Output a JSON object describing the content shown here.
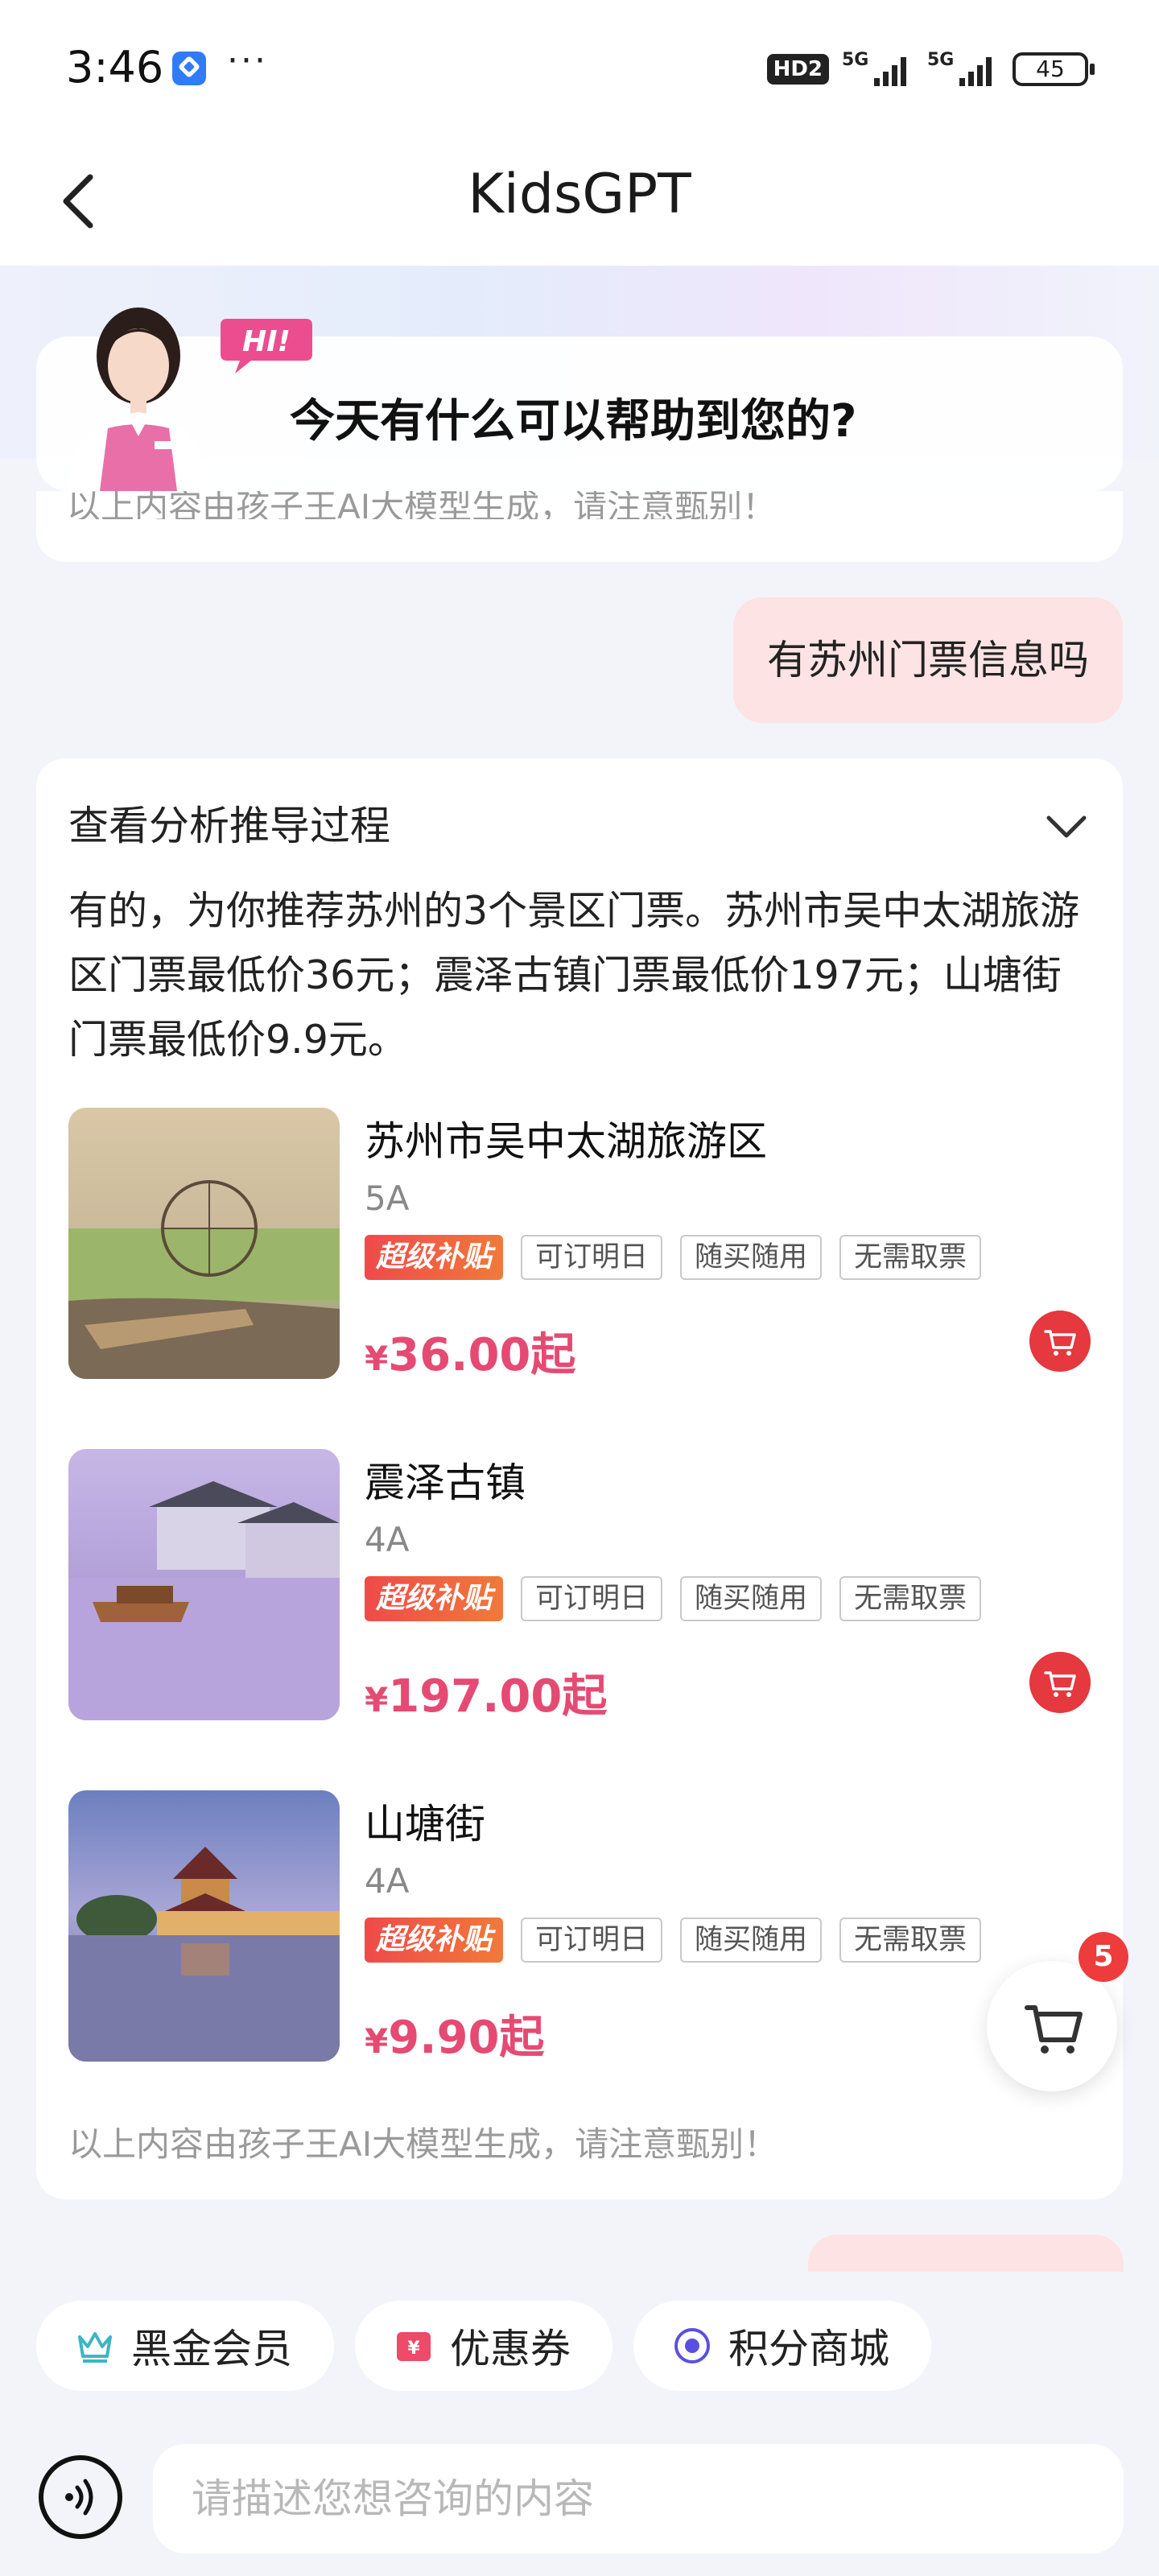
{
  "status_bar": {
    "time": "3:46",
    "dots": "···",
    "hd_label": "HD2",
    "signal1_label": "5G",
    "signal2_label": "5G",
    "battery": "45"
  },
  "nav": {
    "title": "KidsGPT"
  },
  "welcome": {
    "hi": "HI!",
    "greeting": "今天有什么可以帮助到您的?",
    "prev_disclaimer": "以上内容由孩子王AI大模型生成，请注意甄别！"
  },
  "user_message": "有苏州门票信息吗",
  "answer": {
    "analysis_label": "查看分析推导过程",
    "text": "有的，为你推荐苏州的3个景区门票。苏州市吴中太湖旅游区门票最低价36元；震泽古镇门票最低价197元；山塘街门票最低价9.9元。",
    "products": [
      {
        "name": "苏州市吴中太湖旅游区",
        "level": "5A",
        "subsidy_tag": "超级补贴",
        "tags": [
          "可订明日",
          "随买随用",
          "无需取票"
        ],
        "price_symbol": "¥",
        "price": "36.00起"
      },
      {
        "name": "震泽古镇",
        "level": "4A",
        "subsidy_tag": "超级补贴",
        "tags": [
          "可订明日",
          "随买随用",
          "无需取票"
        ],
        "price_symbol": "¥",
        "price": "197.00起"
      },
      {
        "name": "山塘街",
        "level": "4A",
        "subsidy_tag": "超级补贴",
        "tags": [
          "可订明日",
          "随买随用",
          "无需取票"
        ],
        "price_symbol": "¥",
        "price": "9.90起"
      }
    ],
    "disclaimer": "以上内容由孩子王AI大模型生成，请注意甄别！"
  },
  "cart": {
    "count": "5"
  },
  "chips": [
    {
      "label": "黑金会员",
      "icon": "crown-icon"
    },
    {
      "label": "优惠券",
      "icon": "coupon-icon"
    },
    {
      "label": "积分商城",
      "icon": "points-icon"
    }
  ],
  "input": {
    "placeholder": "请描述您想咨询的内容"
  },
  "colors": {
    "accent_price": "#e54a73",
    "cart_red": "#e5383f",
    "user_bubble": "#fde3e3"
  }
}
